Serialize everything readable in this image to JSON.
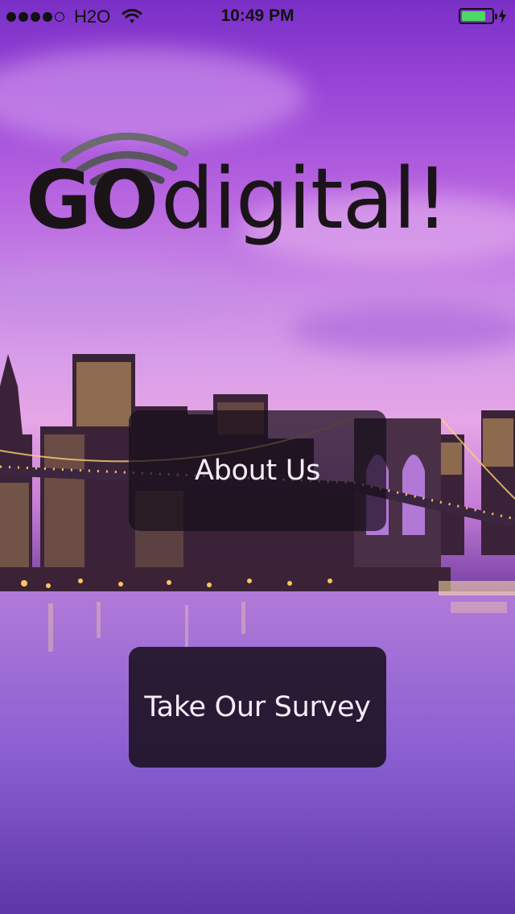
{
  "status_bar": {
    "carrier": "H2O",
    "time": "10:49 PM",
    "battery_level": 0.8,
    "battery_color": "#4cd964",
    "signal_bars": 4,
    "signal_total": 5
  },
  "logo": {
    "text_go": "GO",
    "text_digital": "digital!",
    "icon": "wifi-waves-icon"
  },
  "buttons": {
    "about_label": "About Us",
    "survey_label": "Take Our Survey"
  },
  "theme": {
    "button_bg": "#160e1a",
    "button_text": "#f3eef6",
    "sky_top": "#7a2fc6",
    "sky_mid": "#e6a6e6",
    "water": "#8a5fd0"
  }
}
